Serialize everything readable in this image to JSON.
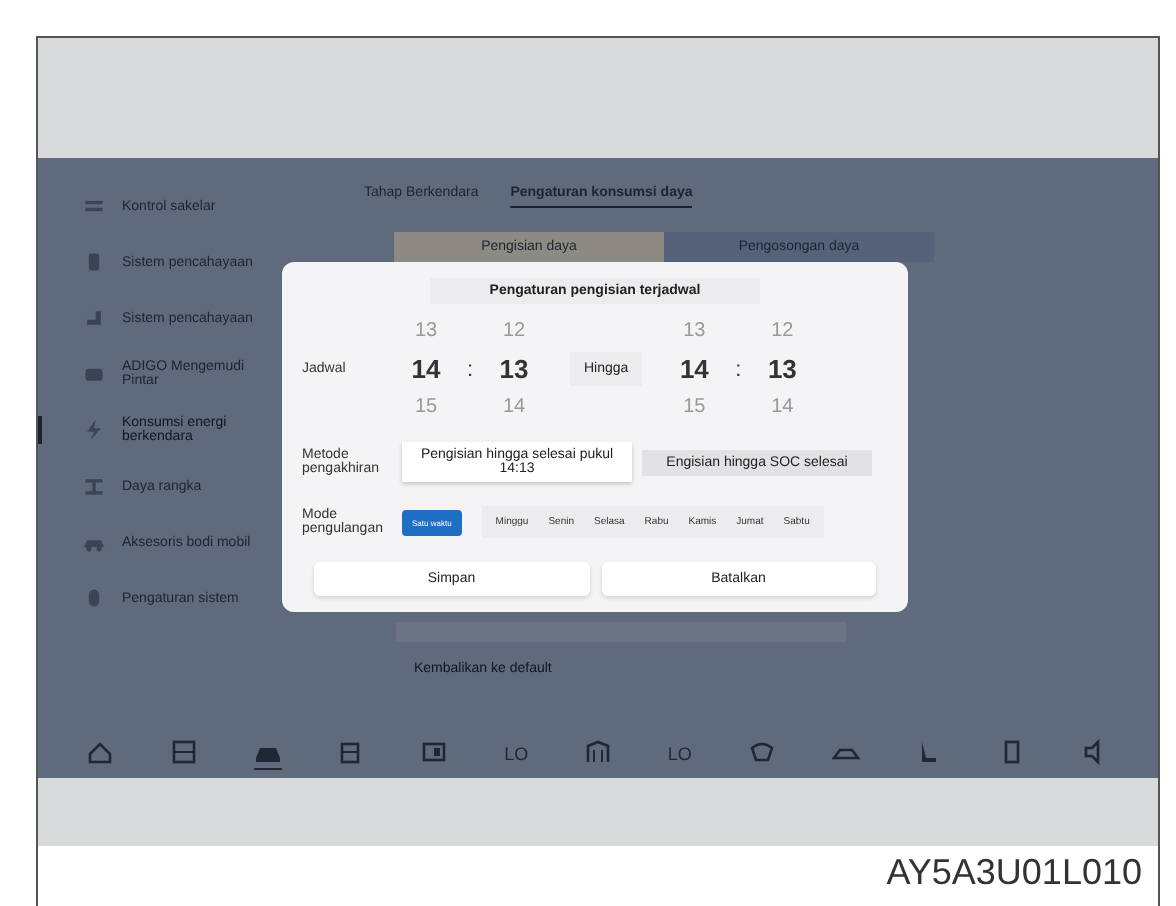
{
  "sidebar": {
    "items": [
      {
        "label": "Kontrol sakelar",
        "selected": false
      },
      {
        "label": "Sistem pencahayaan",
        "selected": false
      },
      {
        "label": "Sistem pencahayaan",
        "selected": false
      },
      {
        "label": "ADIGO Mengemudi Pintar",
        "selected": false
      },
      {
        "label": "Konsumsi energi berkendara",
        "selected": true
      },
      {
        "label": "Daya rangka",
        "selected": false
      },
      {
        "label": "Aksesoris bodi mobil",
        "selected": false
      },
      {
        "label": "Pengaturan sistem",
        "selected": false
      }
    ]
  },
  "tabs": [
    {
      "label": "Tahap Berkendara",
      "selected": false
    },
    {
      "label": "Pengaturan konsumsi daya",
      "selected": true
    }
  ],
  "segments": [
    {
      "label": "Pengisian daya",
      "selected": true
    },
    {
      "label": "Pengosongan daya",
      "selected": false
    }
  ],
  "reset_link": "Kembalikan ke default",
  "dock": [
    {
      "kind": "icon",
      "selected": false
    },
    {
      "kind": "icon",
      "selected": false
    },
    {
      "kind": "icon",
      "selected": true
    },
    {
      "kind": "icon",
      "selected": false
    },
    {
      "kind": "icon",
      "selected": false
    },
    {
      "kind": "text",
      "label": "LO"
    },
    {
      "kind": "icon",
      "selected": false
    },
    {
      "kind": "text",
      "label": "LO"
    },
    {
      "kind": "icon",
      "selected": false
    },
    {
      "kind": "icon",
      "selected": false
    },
    {
      "kind": "icon",
      "selected": false
    },
    {
      "kind": "icon",
      "selected": false
    },
    {
      "kind": "icon",
      "selected": false
    }
  ],
  "dialog": {
    "title": "Pengaturan pengisian terjadwal",
    "schedule_label": "Jadwal",
    "until_label": "Hingga",
    "start": {
      "hours": [
        "13",
        "14",
        "15"
      ],
      "minutes": [
        "12",
        "13",
        "14"
      ]
    },
    "end": {
      "hours": [
        "13",
        "14",
        "15"
      ],
      "minutes": [
        "12",
        "13",
        "14"
      ]
    },
    "separator": ":",
    "method_label": "Metode pengakhiran",
    "methods": [
      {
        "label": "Pengisian hingga selesai pukul 14:13",
        "selected": true
      },
      {
        "label": "Engisian hingga SOC selesai",
        "selected": false
      }
    ],
    "repeat_label": "Mode pengulangan",
    "once": {
      "label": "Satu waktu",
      "selected": true
    },
    "days": [
      {
        "label": "Minggu",
        "selected": false
      },
      {
        "label": "Senin",
        "selected": false
      },
      {
        "label": "Selasa",
        "selected": false
      },
      {
        "label": "Rabu",
        "selected": false
      },
      {
        "label": "Kamis",
        "selected": false
      },
      {
        "label": "Jumat",
        "selected": false
      },
      {
        "label": "Sabtu",
        "selected": false
      }
    ],
    "buttons": [
      "Simpan",
      "Batalkan"
    ]
  },
  "figure_code": "AY5A3U01L010"
}
